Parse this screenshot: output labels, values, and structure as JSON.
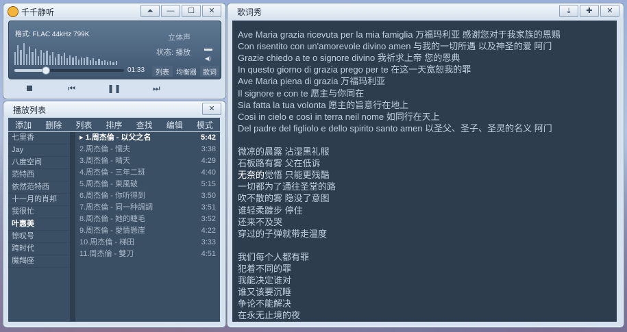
{
  "player": {
    "title": "千千静听",
    "format": "格式: FLAC 44kHz 799K",
    "stereo": "立体声",
    "status": "状态: 播放",
    "time": "01:33",
    "progress": 0.28,
    "mode_buttons": [
      "列表",
      "均衡器",
      "歌词"
    ],
    "spectrum": [
      0.6,
      0.9,
      0.7,
      1.0,
      0.5,
      0.85,
      0.6,
      0.75,
      0.4,
      0.7,
      0.55,
      0.65,
      0.45,
      0.6,
      0.35,
      0.5,
      0.4,
      0.55,
      0.3,
      0.45,
      0.35,
      0.4,
      0.25,
      0.35,
      0.3,
      0.38,
      0.22,
      0.3,
      0.2,
      0.28,
      0.18,
      0.22,
      0.15,
      0.2,
      0.14,
      0.18
    ]
  },
  "playlist": {
    "title": "播放列表",
    "menu": [
      "添加",
      "删除",
      "列表",
      "排序",
      "查找",
      "编辑",
      "模式"
    ],
    "lists": [
      "七里香",
      "Jay",
      "八度空间",
      "范特西",
      "依然范特西",
      "十一月的肖邦",
      "我很忙",
      "叶惠美",
      "惊叹号",
      "跨时代",
      "魔羯座"
    ],
    "selected_list": 7,
    "songs": [
      {
        "title": "1.周杰倫 - 以父之名",
        "dur": "5:42"
      },
      {
        "title": "2.周杰倫 - 懦夫",
        "dur": "3:38"
      },
      {
        "title": "3.周杰倫 - 晴天",
        "dur": "4:29"
      },
      {
        "title": "4.周杰倫 - 三年二班",
        "dur": "4:40"
      },
      {
        "title": "5.周杰倫 - 東風破",
        "dur": "5:15"
      },
      {
        "title": "6.周杰倫 - 你听得到",
        "dur": "3:50"
      },
      {
        "title": "7.周杰倫 - 同一种調調",
        "dur": "3:51"
      },
      {
        "title": "8.周杰倫 - 她的睫毛",
        "dur": "3:52"
      },
      {
        "title": "9.周杰倫 - 愛情懸崖",
        "dur": "4:22"
      },
      {
        "title": "10.周杰倫 - 梯田",
        "dur": "3:33"
      },
      {
        "title": "11.周杰倫 - 雙刀",
        "dur": "4:51"
      }
    ],
    "current_song": 0
  },
  "lyrics": {
    "title": "歌词秀",
    "lines": [
      "Ave Maria grazia ricevuta per la mia famiglia     万福玛利亚 感谢您对于我家族的恩赐",
      "Con risentito con un'amorevole divino amen     与我的一切所遇 以及神圣的爱 阿门",
      "Grazie chiedo a te o signore divino     我祈求上帝 您的恩典",
      "In questo giorno di grazia prego per te     在这一天宽恕我的罪",
      "Ave Maria piena di grazia     万福玛利亚",
      "Il signore e con te     愿主与你同在",
      "Sia fatta la tua volonta     愿主的旨意行在地上",
      "Così in cielo e così in terra neil nome     如同行在天上",
      "Del padre del figliolo e dello spirito santo amen     以圣父、圣子、圣灵的名义 阿门",
      "",
      "微凉的晨露 沾湿黑礼服",
      "石板路有雾 父在低诉",
      "无奈的觉悟 只能更残酷",
      "一切都为了通往圣堂的路",
      "吹不散的雾 隐没了意图",
      "谁轻柔踱步 停住",
      "还来不及哭",
      "穿过的子弹就带走温度",
      "",
      "我们每个人都有罪",
      "犯着不同的罪",
      "我能决定谁对",
      "谁又该要沉睡",
      "争论不能解决",
      "在永无止境的夜"
    ],
    "highlight": {
      "line": 12,
      "prefix": "无奈的",
      "rest": "觉悟 只能更残酷"
    }
  }
}
